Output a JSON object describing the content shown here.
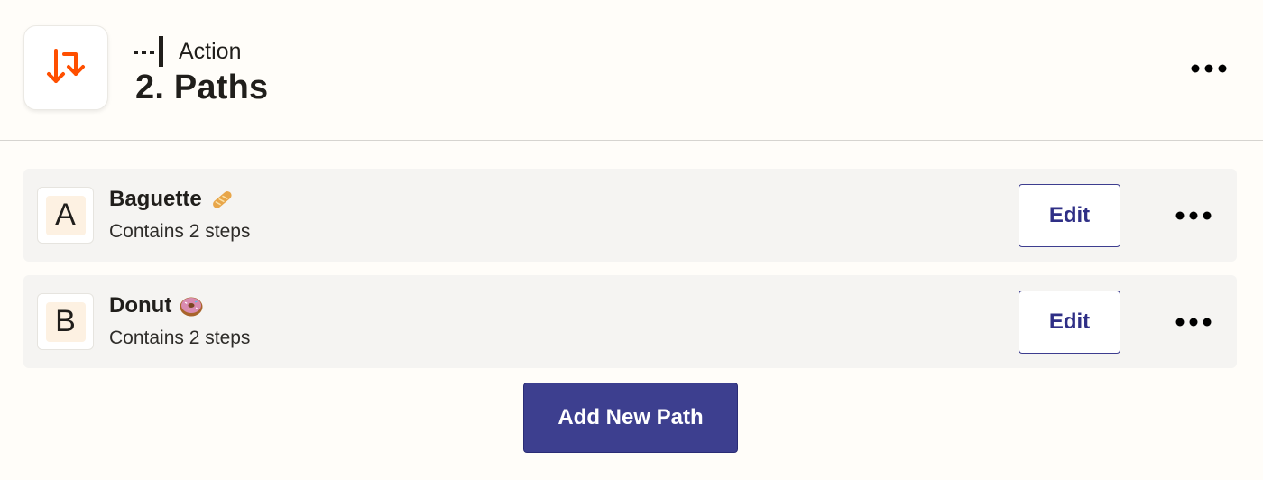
{
  "header": {
    "step_type": "Action",
    "title": "2. Paths",
    "icon": "paths-icon",
    "accent_color": "#ff4f00"
  },
  "paths": [
    {
      "letter": "A",
      "name": "Baguette",
      "emoji": "baguette-icon",
      "steps_label": "Contains 2 steps",
      "edit_label": "Edit"
    },
    {
      "letter": "B",
      "name": "Donut",
      "emoji": "doughnut-icon",
      "steps_label": "Contains 2 steps",
      "edit_label": "Edit"
    }
  ],
  "add_path_label": "Add New Path",
  "colors": {
    "primary_button": "#3d3f8f",
    "edit_text": "#2f2f86",
    "card_background": "#f5f4f2"
  }
}
